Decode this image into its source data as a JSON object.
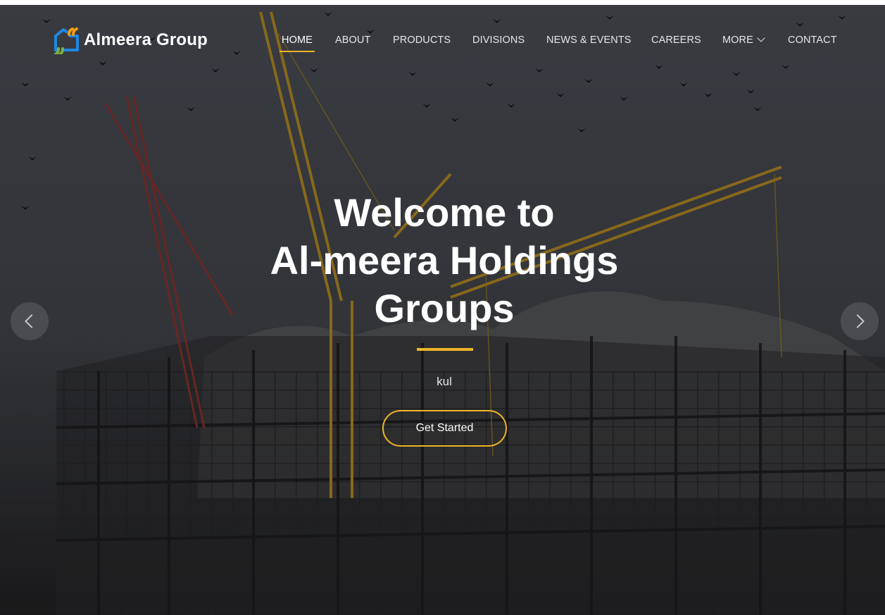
{
  "brand": {
    "name": "Almeera Group",
    "logo_icon": "almeera-logo-icon",
    "colors": {
      "accent": "#f0b429",
      "logo_blue": "#1e88e5",
      "logo_orange": "#f39c12",
      "logo_green": "#7cb342"
    }
  },
  "nav": {
    "items": [
      {
        "label": "HOME",
        "active": true
      },
      {
        "label": "ABOUT"
      },
      {
        "label": "PRODUCTS"
      },
      {
        "label": "DIVISIONS"
      },
      {
        "label": "NEWS & EVENTS"
      },
      {
        "label": "CAREERS"
      },
      {
        "label": "MORE",
        "has_dropdown": true
      },
      {
        "label": "CONTACT"
      }
    ]
  },
  "hero": {
    "title_line1": "Welcome to",
    "title_line2": "Al-meera Holdings",
    "title_line3": "Groups",
    "subtitle": "kul",
    "cta_label": "Get Started",
    "prev_icon": "chevron-left-icon",
    "next_icon": "chevron-right-icon",
    "background_image": "construction cranes and building under construction with birds"
  }
}
